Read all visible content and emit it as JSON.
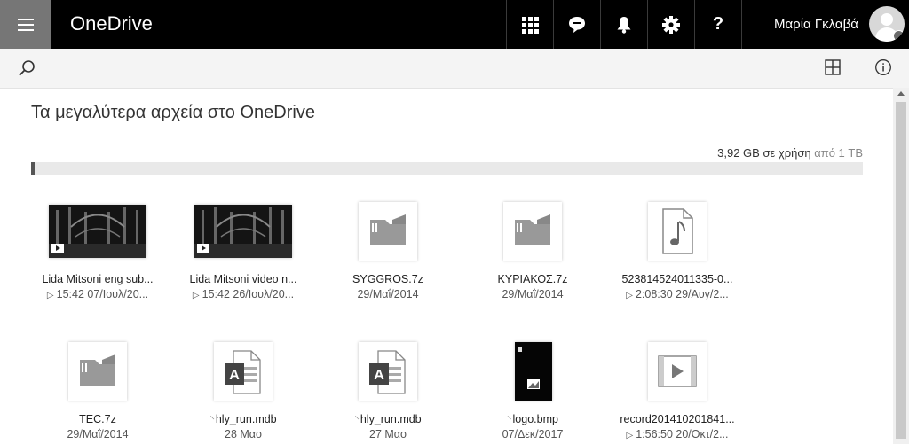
{
  "header": {
    "app_title": "OneDrive",
    "user_name": "Μαρία Γκλαβά",
    "icons": [
      "app-launcher-icon",
      "chat-icon",
      "bell-icon",
      "gear-icon",
      "help-icon"
    ],
    "help_label": "?"
  },
  "main": {
    "title": "Τα μεγαλύτερα αρχεία στο OneDrive",
    "storage": {
      "used": "3,92 GB σε χρήση",
      "total": "από 1 TB",
      "fraction": 0.004
    }
  },
  "files": [
    {
      "name": "Lida Mitsoni eng sub...",
      "meta": "15:42  07/Ιουλ/20...",
      "type": "video"
    },
    {
      "name": "Lida Mitsoni video n...",
      "meta": "15:42  26/Ιουλ/20...",
      "type": "video"
    },
    {
      "name": "SYGGROS.7z",
      "meta": "29/Μαΐ/2014",
      "type": "archive"
    },
    {
      "name": "ΚΥΡΙΑΚΟΣ.7z",
      "meta": "29/Μαΐ/2014",
      "type": "archive"
    },
    {
      "name": "523814524011335-0...",
      "meta": "2:08:30  29/Αυγ/2...",
      "type": "audio"
    },
    {
      "name": "TEC.7z",
      "meta": "29/Μαΐ/2014",
      "type": "archive"
    },
    {
      "name": "hly_run.mdb",
      "meta": "28 Μαο",
      "type": "access"
    },
    {
      "name": "hly_run.mdb",
      "meta": "27 Μαο",
      "type": "access"
    },
    {
      "name": "logo.bmp",
      "meta": "07/Δεκ/2017",
      "type": "image"
    },
    {
      "name": "record201410201841...",
      "meta": "1:56:50  20/Οκτ/2...",
      "type": "video-file"
    }
  ]
}
